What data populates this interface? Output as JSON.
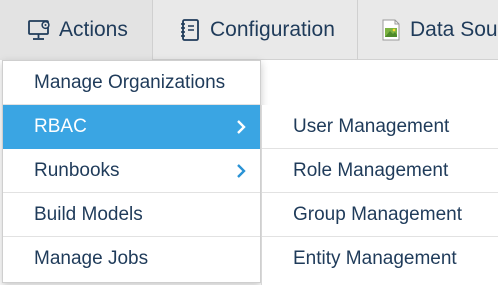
{
  "navbar": {
    "actions": {
      "label": "Actions",
      "icon": "monitor-gear-icon"
    },
    "configuration": {
      "label": "Configuration",
      "icon": "notebook-icon"
    },
    "data_sources": {
      "label": "Data Sou",
      "icon": "broken-image-icon"
    }
  },
  "menu": {
    "items": [
      {
        "label": "Manage Organizations",
        "has_submenu": false,
        "active": false
      },
      {
        "label": "RBAC",
        "has_submenu": true,
        "active": true
      },
      {
        "label": "Runbooks",
        "has_submenu": true,
        "active": false
      },
      {
        "label": "Build Models",
        "has_submenu": false,
        "active": false
      },
      {
        "label": "Manage Jobs",
        "has_submenu": false,
        "active": false
      }
    ]
  },
  "submenu": {
    "items": [
      {
        "label": "User Management"
      },
      {
        "label": "Role Management"
      },
      {
        "label": "Group Management"
      },
      {
        "label": "Entity Management"
      }
    ]
  },
  "colors": {
    "text": "#1f3b5a",
    "accent": "#3aa5e3",
    "chevron": "#2a93d5",
    "navbar_bg": "#e9e9e9"
  }
}
